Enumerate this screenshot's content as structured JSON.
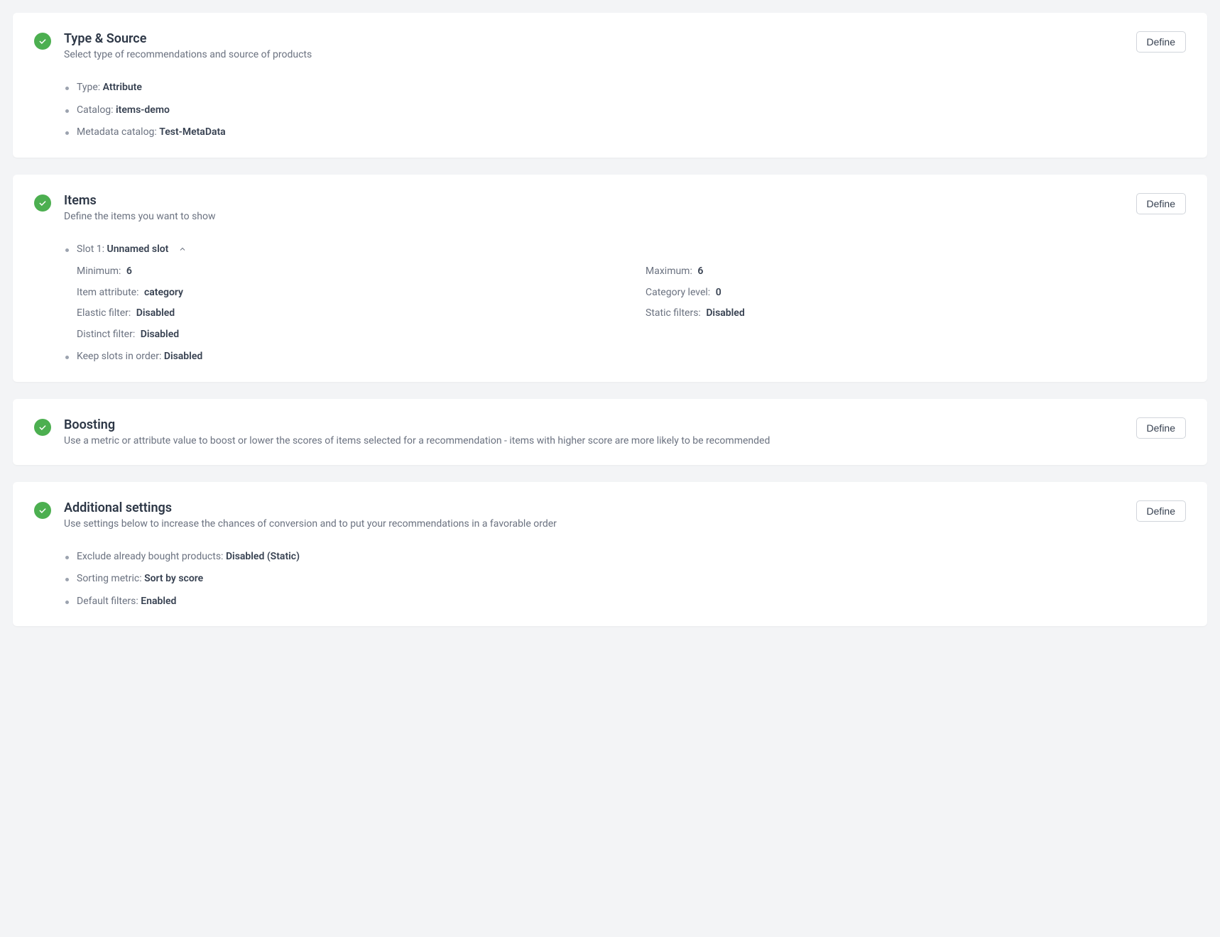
{
  "buttons": {
    "define": "Define"
  },
  "cards": {
    "typeSource": {
      "title": "Type & Source",
      "subtitle": "Select type of recommendations and source of products",
      "items": {
        "type": {
          "label": "Type: ",
          "value": "Attribute"
        },
        "catalog": {
          "label": "Catalog: ",
          "value": "items-demo"
        },
        "metadata": {
          "label": "Metadata catalog: ",
          "value": "Test-MetaData"
        }
      }
    },
    "items": {
      "title": "Items",
      "subtitle": "Define the items you want to show",
      "slot": {
        "label": "Slot 1: ",
        "name": "Unnamed slot",
        "props": {
          "minimum": {
            "label": "Minimum:",
            "value": "6"
          },
          "maximum": {
            "label": "Maximum:",
            "value": "6"
          },
          "itemAttr": {
            "label": "Item attribute:",
            "value": "category"
          },
          "catLevel": {
            "label": "Category level:",
            "value": "0"
          },
          "elastic": {
            "label": "Elastic filter:",
            "value": "Disabled"
          },
          "staticf": {
            "label": "Static filters:",
            "value": "Disabled"
          },
          "distinct": {
            "label": "Distinct filter:",
            "value": "Disabled"
          }
        }
      },
      "keepOrder": {
        "label": "Keep slots in order: ",
        "value": "Disabled"
      }
    },
    "boosting": {
      "title": "Boosting",
      "subtitle": "Use a metric or attribute value to boost or lower the scores of items selected for a recommendation - items with higher score are more likely to be recommended"
    },
    "additional": {
      "title": "Additional settings",
      "subtitle": "Use settings below to increase the chances of conversion and to put your recommendations in a favorable order",
      "items": {
        "exclude": {
          "label": "Exclude already bought products: ",
          "value": "Disabled (Static)"
        },
        "sorting": {
          "label": "Sorting metric: ",
          "value": "Sort by score"
        },
        "defaults": {
          "label": "Default filters: ",
          "value": "Enabled"
        }
      }
    }
  }
}
